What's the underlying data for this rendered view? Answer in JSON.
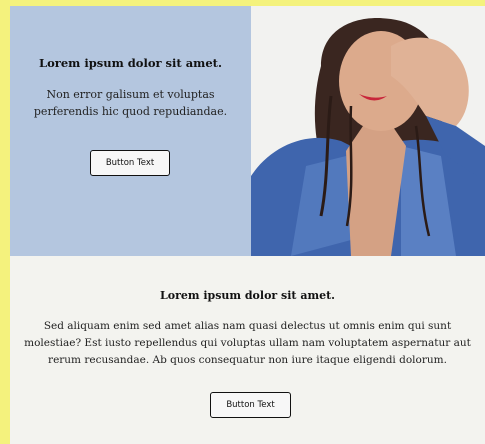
{
  "top_card": {
    "title": "Lorem ipsum dolor sit amet.",
    "text": "Non error galisum et voluptas perferendis hic quod repudiandae.",
    "button_label": "Button Text"
  },
  "hero_image": {
    "icon": "woman-portrait-photo",
    "colors": {
      "jacket": "#3f65ad",
      "skin": "#d9a98a",
      "hair": "#3a2620",
      "lips": "#c8263a"
    }
  },
  "bottom_section": {
    "title": "Lorem ipsum dolor sit amet.",
    "text": "Sed aliquam enim sed amet alias nam quasi delectus ut omnis enim qui sunt molestiae? Est iusto repellendus qui voluptas ullam nam voluptatem aspernatur aut rerum recusandae. Ab quos consequatur non iure itaque eligendi dolorum.",
    "button_label": "Button Text"
  },
  "colors": {
    "page_background": "#f4f27d",
    "frame_background": "#f3f3ef",
    "card_background": "#b4c6df"
  }
}
